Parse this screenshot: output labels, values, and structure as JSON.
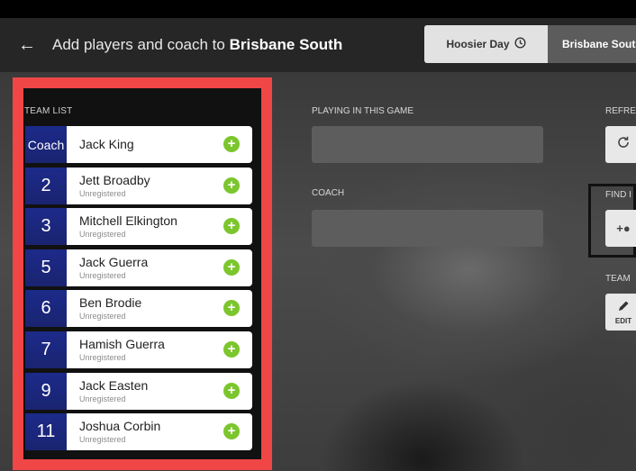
{
  "header": {
    "back_icon": "arrow-left-icon",
    "title_prefix": "Add players and coach to",
    "title_team": "Brisbane South"
  },
  "tabs": [
    {
      "label": "Hoosier Day",
      "icon": "clock-icon"
    },
    {
      "label": "Brisbane South"
    }
  ],
  "team_list": {
    "label": "TEAM LIST",
    "rows": [
      {
        "number": "Coach",
        "name": "Jack King",
        "status": ""
      },
      {
        "number": "2",
        "name": "Jett Broadby",
        "status": "Unregistered"
      },
      {
        "number": "3",
        "name": "Mitchell Elkington",
        "status": "Unregistered"
      },
      {
        "number": "5",
        "name": "Jack Guerra",
        "status": "Unregistered"
      },
      {
        "number": "6",
        "name": "Ben Brodie",
        "status": "Unregistered"
      },
      {
        "number": "7",
        "name": "Hamish Guerra",
        "status": "Unregistered"
      },
      {
        "number": "9",
        "name": "Jack Easten",
        "status": "Unregistered"
      },
      {
        "number": "11",
        "name": "Joshua Corbin",
        "status": "Unregistered"
      }
    ]
  },
  "playing": {
    "label": "PLAYING IN THIS GAME"
  },
  "coach": {
    "label": "COACH"
  },
  "side": {
    "refresh_label": "REFRE",
    "find_label": "FIND I",
    "team_label": "TEAM",
    "edit_label": "EDIT"
  },
  "colors": {
    "accent_red": "#f04646",
    "number_bg": "#1c2a8a",
    "add_green": "#7bc62d"
  }
}
